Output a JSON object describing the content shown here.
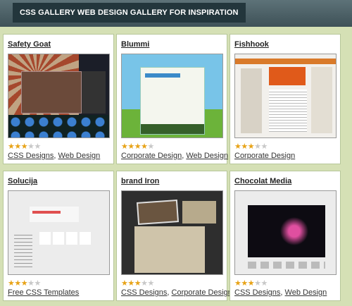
{
  "page": {
    "title": "CSS GALLERY WEB DESIGN GALLERY FOR INSPIRATION"
  },
  "gallery": [
    {
      "name": "Safety Goat",
      "rating": 3,
      "categories": [
        "CSS Designs",
        "Web Design"
      ]
    },
    {
      "name": "Blummi",
      "rating": 4,
      "categories": [
        "Corporate Design",
        "Web Design"
      ]
    },
    {
      "name": "Fishhook",
      "rating": 3,
      "categories": [
        "Corporate Design"
      ]
    },
    {
      "name": "Solucija",
      "rating": 3,
      "categories": [
        "Free CSS Templates"
      ]
    },
    {
      "name": "brand Iron",
      "rating": 3,
      "categories": [
        "CSS Designs",
        "Corporate Design"
      ]
    },
    {
      "name": "Chocolat Media",
      "rating": 3,
      "categories": [
        "CSS Designs",
        "Web Design"
      ]
    }
  ],
  "rating_max": 5,
  "colors": {
    "header": "#3e5157",
    "title_tab": "#23363c",
    "background": "#d5e0b5",
    "star_on": "#e8a317",
    "star_off": "#c8c8c8"
  },
  "icons": {
    "star": "star-icon"
  }
}
